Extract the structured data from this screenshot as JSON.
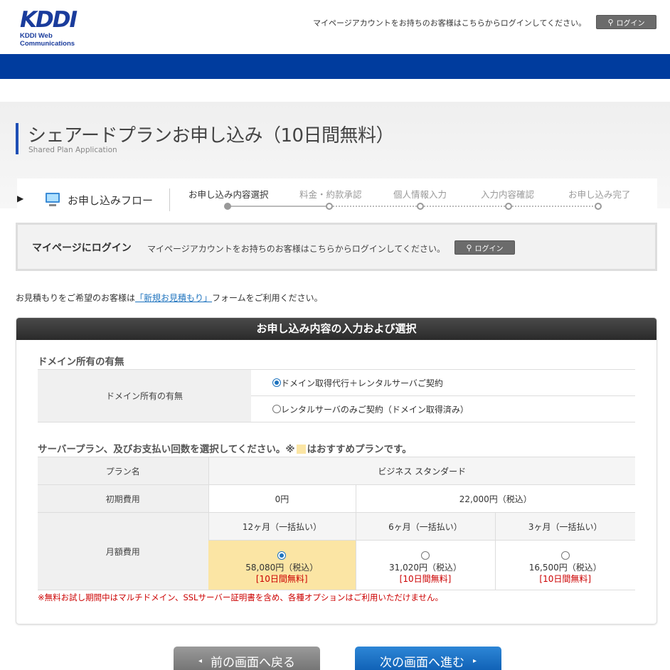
{
  "header": {
    "logo_mark": "KDDI",
    "logo_sub": "KDDI Web Communications",
    "login_note": "マイページアカウントをお持ちのお客様はこちらからログインしてください。",
    "login_label": "ログイン"
  },
  "page": {
    "title": "シェアードプランお申し込み（10日間無料）",
    "subtitle": "Shared Plan Application"
  },
  "flow": {
    "label": "お申し込みフロー",
    "steps": [
      {
        "label": "お申し込み内容選択",
        "active": true
      },
      {
        "label": "料金・約款承認",
        "active": false
      },
      {
        "label": "個人情報入力",
        "active": false
      },
      {
        "label": "入力内容確認",
        "active": false
      },
      {
        "label": "お申し込み完了",
        "active": false
      }
    ]
  },
  "mypage": {
    "title": "マイページにログイン",
    "note": "マイページアカウントをお持ちのお客様はこちらからログインしてください。",
    "login_label": "ログイン"
  },
  "estimate": {
    "before": "お見積もりをご希望のお客様は",
    "link": "「新規お見積もり」",
    "after": "フォームをご利用ください。"
  },
  "panel": {
    "title": "お申し込み内容の入力および選択",
    "domain_section": {
      "title": "ドメイン所有の有無",
      "row_label": "ドメイン所有の有無",
      "options": [
        {
          "label": "ドメイン取得代行＋レンタルサーバご契約",
          "selected": true
        },
        {
          "label": "レンタルサーバのみご契約（ドメイン取得済み）",
          "selected": false
        }
      ]
    },
    "plan_section": {
      "title_before": "サーバープラン、及びお支払い回数を選択してください。※",
      "title_after": "はおすすめプランです。",
      "plan_name_label": "プラン名",
      "plan_name": "ビジネス スタンダード",
      "initial_label": "初期費用",
      "initial_free": "0円",
      "initial_paid": "22,000円（税込）",
      "monthly_label": "月額費用",
      "options": [
        {
          "period": "12ヶ月（一括払い）",
          "price": "58,080円（税込）",
          "free": "[10日間無料]",
          "selected": true
        },
        {
          "period": "6ヶ月（一括払い）",
          "price": "31,020円（税込）",
          "free": "[10日間無料]",
          "selected": false
        },
        {
          "period": "3ヶ月（一括払い）",
          "price": "16,500円（税込）",
          "free": "[10日間無料]",
          "selected": false
        }
      ],
      "warning": "※無料お試し期間中はマルチドメイン、SSLサーバー証明書を含め、各種オプションはご利用いただけません。"
    }
  },
  "nav": {
    "prev": "前の画面へ戻る",
    "next": "次の画面へ進む"
  },
  "colors": {
    "brand_blue": "#003c9e",
    "recommend": "#fbe5a4",
    "alert_red": "#cc0000"
  }
}
